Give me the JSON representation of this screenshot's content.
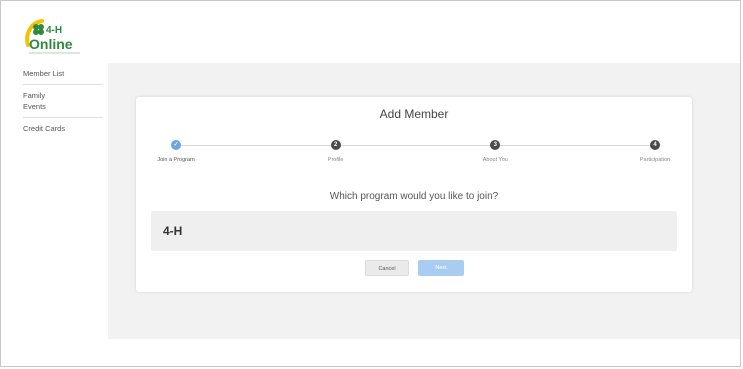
{
  "logo": {
    "text_top": "4-H",
    "text_bottom": "Online"
  },
  "sidebar": {
    "groups": [
      [
        "Member List"
      ],
      [
        "Family",
        "Events"
      ],
      [
        "Credit Cards"
      ]
    ]
  },
  "dialog": {
    "title": "Add Member",
    "steps": [
      {
        "number": "✓",
        "label": "Join a Program",
        "state": "active"
      },
      {
        "number": "2",
        "label": "Profile",
        "state": "pending"
      },
      {
        "number": "3",
        "label": "About You",
        "state": "pending"
      },
      {
        "number": "4",
        "label": "Participation",
        "state": "pending"
      }
    ],
    "question": "Which program would you like to join?",
    "program_option": "4-H",
    "cancel_label": "Cancel",
    "next_label": "Next"
  },
  "colors": {
    "accent": "#6aa6dc",
    "next_disabled": "#a9cdf0",
    "logo_green": "#2e8b3e",
    "logo_yellow": "#f2c200"
  }
}
